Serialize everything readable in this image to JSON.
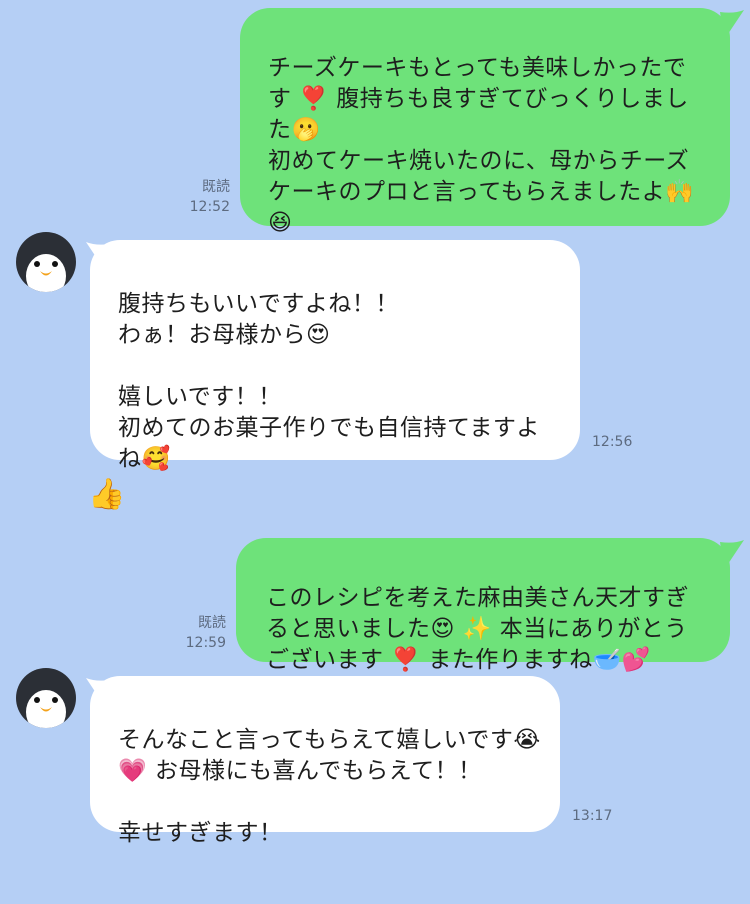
{
  "messages": [
    {
      "side": "outgoing",
      "text": "チーズケーキもとっても美味しかったです ❣️ 腹持ちも良すぎてびっくりしました🫢\n初めてケーキ焼いたのに、母からチーズケーキのプロと言ってもらえましたよ🙌😆",
      "read": "既読",
      "time": "12:52"
    },
    {
      "side": "incoming",
      "text": "腹持ちもいいですよね！！\nわぁ！お母様から😍\n\n嬉しいです！！\n初めてのお菓子作りでも自信持てますよね🥰",
      "time": "12:56"
    },
    {
      "side": "outgoing",
      "text": "このレシピを考えた麻由美さん天才すぎると思いました😍 ✨ 本当にありがとうございます ❣️ また作りますね🥣💕",
      "read": "既読",
      "time": "12:59"
    },
    {
      "side": "incoming",
      "text": "そんなこと言ってもらえて嬉しいです😭 💗 お母様にも喜んでもらえて！！\n\n幸せすぎます！",
      "time": "13:17"
    }
  ],
  "colors": {
    "background": "#b5cff5",
    "outgoing_bubble": "#6ee27a",
    "incoming_bubble": "#ffffff",
    "meta_text": "#5d6b80"
  },
  "icons": {
    "avatar": "penguin-avatar-icon",
    "sticker": "thumbs-up-face-sticker"
  }
}
